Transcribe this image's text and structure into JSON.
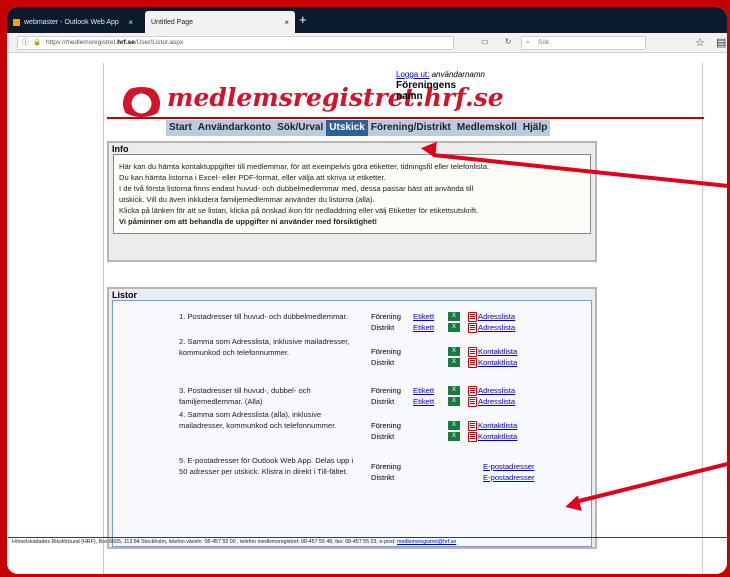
{
  "browser": {
    "tabs": [
      {
        "title": "webmaster - Outlook Web App",
        "close": "×"
      },
      {
        "title": "Untitled Page",
        "close": "×"
      }
    ],
    "new_tab": "+",
    "url_prefix": "https://medlemsregistret.",
    "url_domain": "hrf.se",
    "url_path": "/User/Listor.aspx",
    "search_placeholder": "Sök",
    "icons": [
      "info-icon",
      "lock-icon",
      "reader-view-icon",
      "reload-icon",
      "search-icon",
      "bookmark-star-icon",
      "library-icon"
    ]
  },
  "site": {
    "brand": "medlemsregistret.hrf.se",
    "login_link": "Logga ut:",
    "username": "användarnamn",
    "org_line1": "Föreningens",
    "org_line2": "namn",
    "menu": [
      "Start",
      "Användarkonto",
      "Sök/Urval",
      "Utskick",
      "Förening/Distrikt",
      "Medlemskoll",
      "Hjälp"
    ]
  },
  "info": {
    "title": "Info",
    "lines": [
      "Här kan du hämta kontaktuppgifter till medlemmar, för att exempelvis göra etiketter, tidningsfil eller telefonlista.",
      "Du kan hämta listorna i Excel- eller PDF-format, eller välja att skriva ut etiketter.",
      "I de två första listorna finns endast huvud- och dubbelmedlemmar med, dessa passar bäst att använda till",
      "utskick. Vill du även inkludera familjemedlemmar använder du listorna (alla).",
      "Klicka på länken för att se listan, klicka på önskad ikon för nedladdning eller välj Etiketter för etikettsutskrift."
    ],
    "bold_line": "Vi påminner om att behandla de uppgifter ni använder med försiktighet!"
  },
  "listor": {
    "title": "Listor",
    "items": [
      {
        "desc": "1. Postadresser till huvud- och dubbelmedlemmar.",
        "rows": [
          {
            "label": "Förening",
            "etikett": "Etikett",
            "link": "Adresslista"
          },
          {
            "label": "Distrikt",
            "etikett": "Etikett",
            "link": "Adresslista"
          }
        ]
      },
      {
        "desc": "2. Samma som Adresslista, inklusive mailadresser, kommunkod och telefonnummer.",
        "rows": [
          {
            "label": "Förening",
            "etikett": "",
            "link": "Kontaktlista"
          },
          {
            "label": "Distrikt",
            "etikett": "",
            "link": "Kontaktlista"
          }
        ]
      },
      {
        "desc": "3. Postadresser till huvud-, dubbel- och familjemedlemmar. (Alla)",
        "rows": [
          {
            "label": "Förening",
            "etikett": "Etikett",
            "link": "Adresslista"
          },
          {
            "label": "Distrikt",
            "etikett": "Etikett",
            "link": "Adresslista"
          }
        ]
      },
      {
        "desc": "4. Samma som Adresslista (alla), inklusive mailadresser, kommunkod och telefonnummer.",
        "rows": [
          {
            "label": "Förening",
            "etikett": "",
            "link": "Kontaktlista"
          },
          {
            "label": "Distrikt",
            "etikett": "",
            "link": "Kontaktlista"
          }
        ]
      },
      {
        "desc": "5. E-postadresser för Outlook Web App. Delas upp i 50 adresser per utskick. Klistra in direkt i Till-fältet.",
        "rows": [
          {
            "label": "Förening",
            "etikett": "",
            "link": "E-postadresser"
          },
          {
            "label": "Distrikt",
            "etikett": "",
            "link": "E-postadresser"
          }
        ]
      }
    ]
  },
  "footer": {
    "text": "Hörselskadades Riksförbund (HRF), Box 6605, 113 84 Stockholm, telefon växeln: 08-457 55 00 , telefon medlemsregistret: 08-457 55 48, fax: 08-457 55 03, e-post:",
    "email": "medlemsregistret@hrf.se"
  },
  "colors": {
    "brand_red": "#d3122b",
    "menu_blue": "#b7cce0",
    "active_blue": "#2f5f9a",
    "annotation_red": "#e0001b"
  }
}
